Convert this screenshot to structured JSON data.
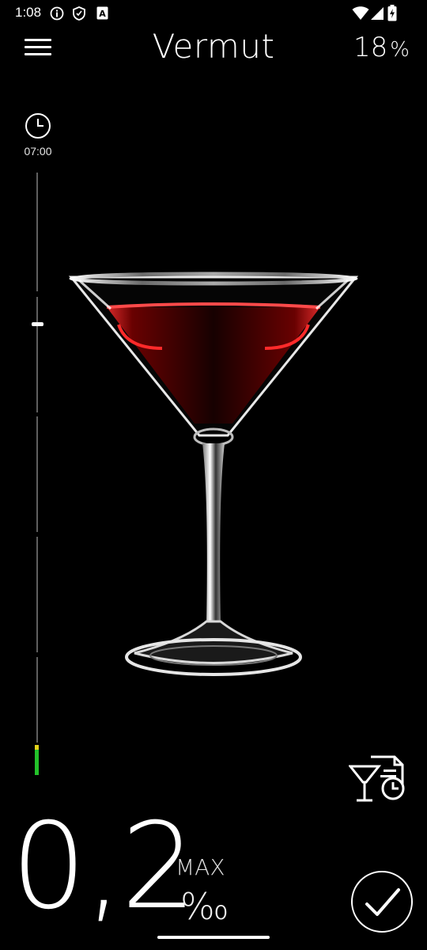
{
  "status_bar": {
    "time": "1:08",
    "icons": [
      "info-icon",
      "shield-icon",
      "a-badge-icon",
      "wifi-icon",
      "signal-icon",
      "battery-charging-icon"
    ]
  },
  "header": {
    "title": "Vermut",
    "percent_value": "18",
    "percent_sign": "%"
  },
  "timeline": {
    "clock_label": "07:00",
    "level_colors": [
      "#e3d21a",
      "#23c22a"
    ]
  },
  "drink": {
    "image": "martini-glass-with-red-vermouth"
  },
  "result": {
    "value": "0,2",
    "max_label": "MAX",
    "unit": "‰"
  },
  "icons": {
    "menu": "hamburger-menu-icon",
    "clock": "clock-icon",
    "history": "drink-history-icon",
    "confirm": "checkmark-icon"
  }
}
